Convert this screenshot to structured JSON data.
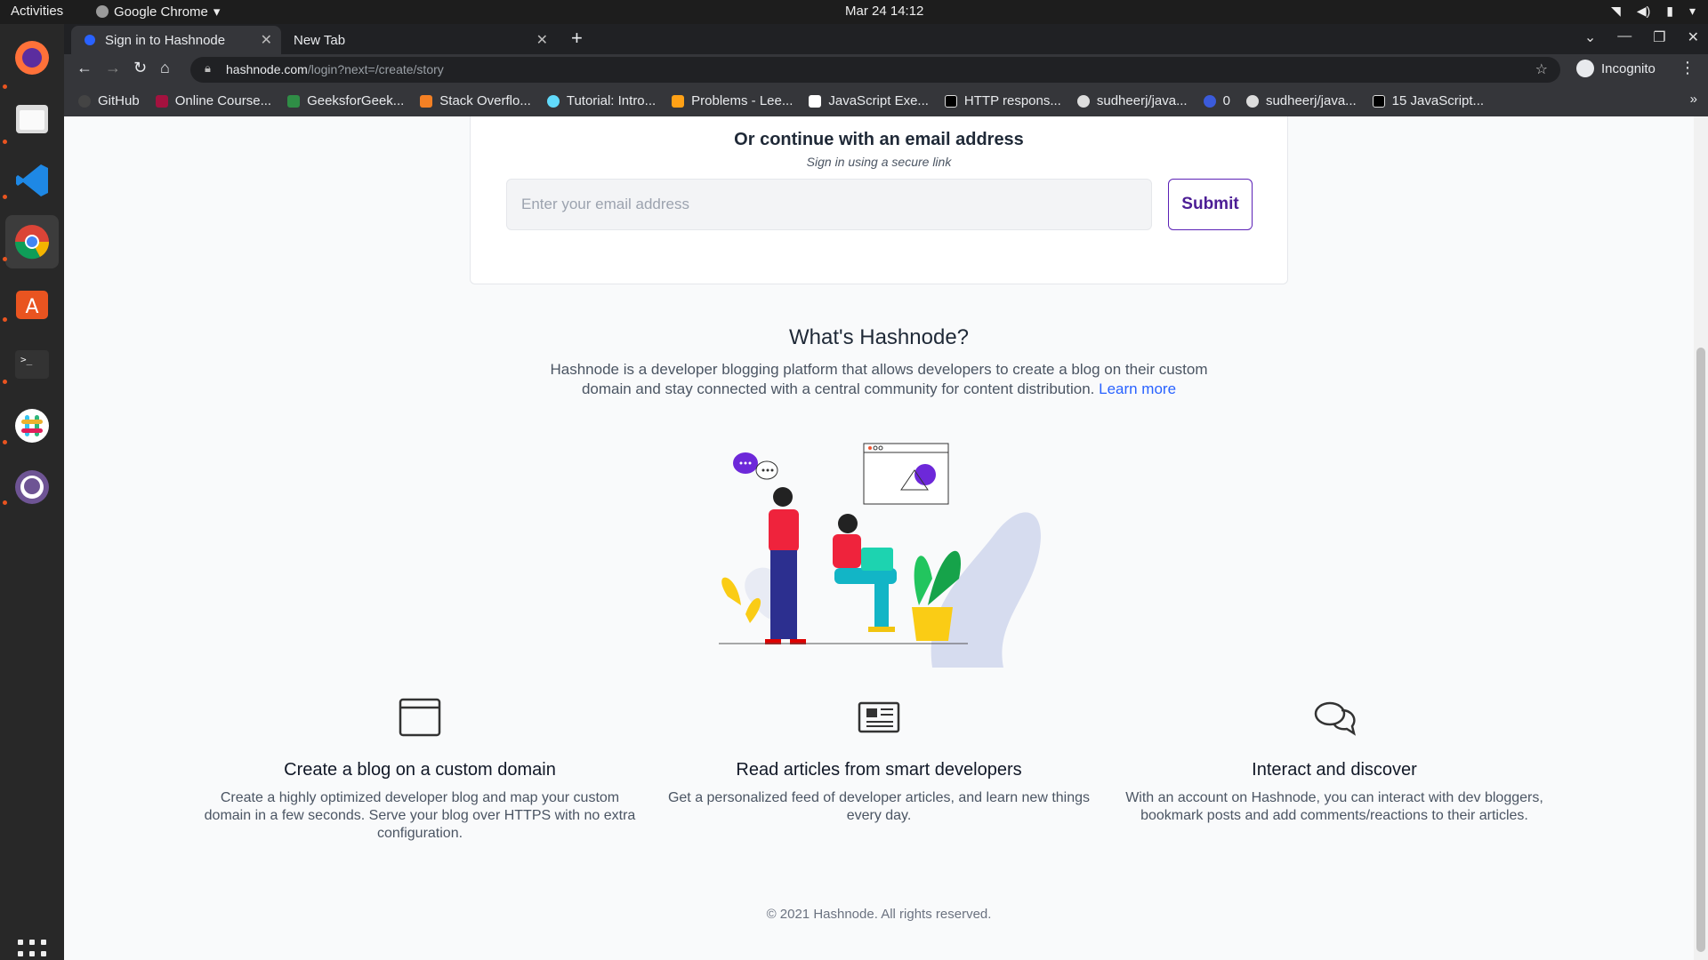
{
  "system": {
    "activities": "Activities",
    "app_name": "Google Chrome",
    "clock": "Mar 24  14:12"
  },
  "browser": {
    "tabs": [
      {
        "label": "Sign in to Hashnode",
        "active": true
      },
      {
        "label": "New Tab",
        "active": false
      }
    ],
    "url_domain": "hashnode.com",
    "url_path": "/login?next=/create/story",
    "profile_label": "Incognito",
    "bookmarks": [
      {
        "label": "GitHub",
        "color": "#333333"
      },
      {
        "label": "Online Course...",
        "color": "#a4123f"
      },
      {
        "label": "GeeksforGeek...",
        "color": "#2f8d46"
      },
      {
        "label": "Stack Overflo...",
        "color": "#f48024"
      },
      {
        "label": "Tutorial: Intro...",
        "color": "#61dafb"
      },
      {
        "label": "Problems - Lee...",
        "color": "#ffa116"
      },
      {
        "label": "JavaScript Exe...",
        "color": "#ffffff"
      },
      {
        "label": "HTTP respons...",
        "color": "#000000"
      },
      {
        "label": "sudheerj/java...",
        "color": "#333333"
      },
      {
        "label": "0",
        "color": "#3b5bdb"
      },
      {
        "label": "sudheerj/java...",
        "color": "#333333"
      },
      {
        "label": "15 JavaScript...",
        "color": "#000000"
      }
    ]
  },
  "login": {
    "heading": "Or continue with an email address",
    "subheading": "Sign in using a secure link",
    "email_placeholder": "Enter your email address",
    "submit_label": "Submit"
  },
  "about": {
    "title": "What's Hashnode?",
    "text": "Hashnode is a developer blogging platform that allows developers to create a blog on their custom domain and stay connected with a central community for content distribution.",
    "link_text": "Learn more"
  },
  "features": [
    {
      "icon": "browser-window-icon",
      "title": "Create a blog on a custom domain",
      "text": "Create a highly optimized developer blog and map your custom domain in a few seconds. Serve your blog over HTTPS with no extra configuration."
    },
    {
      "icon": "newspaper-icon",
      "title": "Read articles from smart developers",
      "text": "Get a personalized feed of developer articles, and learn new things every day."
    },
    {
      "icon": "chat-bubbles-icon",
      "title": "Interact and discover",
      "text": "With an account on Hashnode, you can interact with dev bloggers, bookmark posts and add comments/reactions to their articles."
    }
  ],
  "footer": "© 2021 Hashnode. All rights reserved.",
  "colors": {
    "accent": "#5b21b6",
    "link": "#2962ff",
    "illustration_purple": "#6d28d9"
  }
}
